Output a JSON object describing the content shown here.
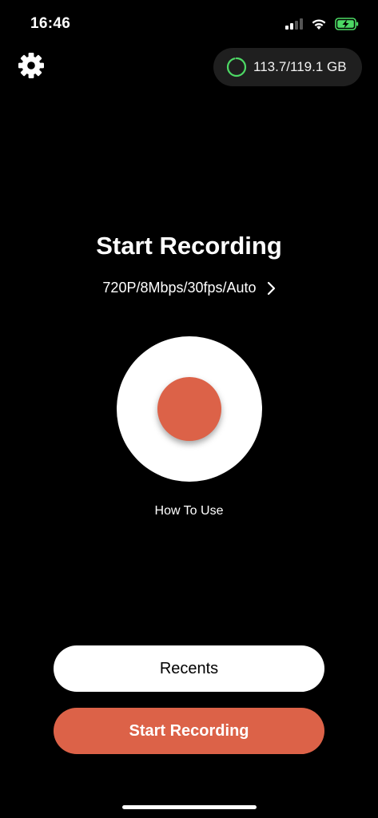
{
  "status_bar": {
    "time": "16:46",
    "icons": [
      "cellular-signal-icon",
      "wifi-icon",
      "battery-charging-icon"
    ],
    "battery_color": "#4cd964"
  },
  "header": {
    "settings_icon": "gear-icon",
    "storage": {
      "text": "113.7/119.1 GB",
      "ring_color": "#4cd964",
      "free_fraction": 0.955
    }
  },
  "main": {
    "title": "Start Recording",
    "settings_summary": "720P/8Mbps/30fps/Auto",
    "record_color": "#dc6248",
    "how_to_label": "How To Use"
  },
  "footer": {
    "recents_label": "Recents",
    "start_label": "Start Recording",
    "accent_color": "#dc6248"
  }
}
